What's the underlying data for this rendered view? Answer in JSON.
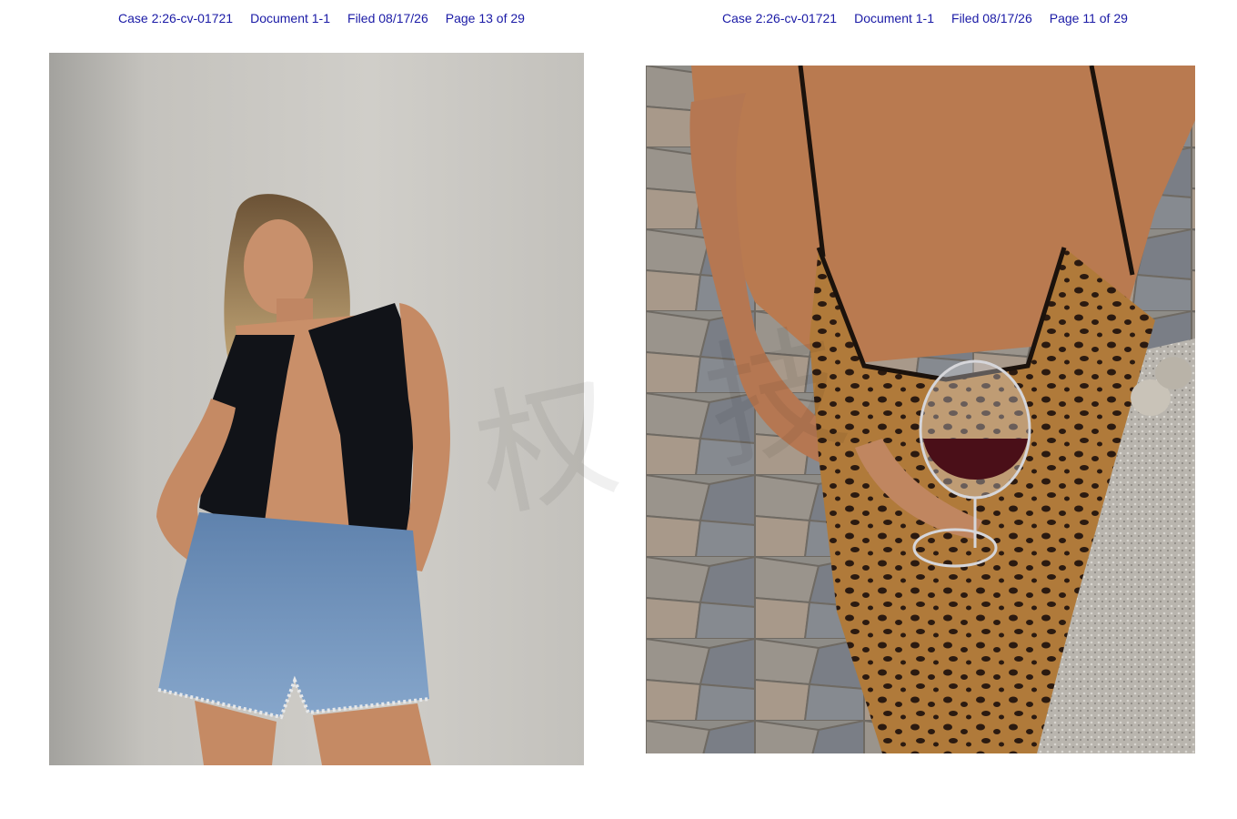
{
  "left_page": {
    "header": {
      "case": "Case 2:26-cv-01721",
      "document": "Document 1-1",
      "filed": "Filed 08/17/26",
      "page": "Page 13 of 29"
    }
  },
  "right_page": {
    "header": {
      "case": "Case 2:26-cv-01721",
      "document": "Document 1-1",
      "filed": "Filed 08/17/26",
      "page": "Page 11 of 29"
    }
  },
  "watermark": {
    "text": "权 技"
  },
  "colors": {
    "header_text": "#1a1aa6",
    "wall": "#cfcdc8",
    "vest": "#111318",
    "denim": "#6d8fb8",
    "skin": "#c9906b",
    "leopard_base": "#b07a3a",
    "stone": "#8b8a86",
    "wine": "#4a0f18"
  }
}
